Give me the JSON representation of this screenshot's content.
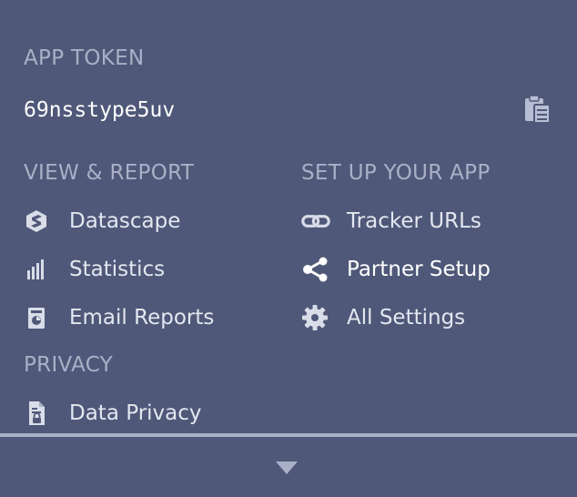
{
  "app_token": {
    "label": "APP TOKEN",
    "value": "69nsstype5uv",
    "copy_icon": "clipboard-icon"
  },
  "view_report": {
    "heading": "VIEW & REPORT",
    "items": [
      {
        "label": "Datascape",
        "icon": "datascape-icon"
      },
      {
        "label": "Statistics",
        "icon": "bar-chart-icon"
      },
      {
        "label": "Email Reports",
        "icon": "email-report-icon"
      }
    ]
  },
  "setup": {
    "heading": "SET UP YOUR APP",
    "items": [
      {
        "label": "Tracker URLs",
        "icon": "link-icon"
      },
      {
        "label": "Partner Setup",
        "icon": "share-icon"
      },
      {
        "label": "All Settings",
        "icon": "gear-icon"
      }
    ]
  },
  "privacy": {
    "heading": "PRIVACY",
    "items": [
      {
        "label": "Data Privacy",
        "icon": "document-lock-icon"
      }
    ]
  },
  "footer": {
    "expand_icon": "chevron-down-icon"
  },
  "colors": {
    "background": "#4f5878",
    "muted_text": "#a9b0c7",
    "text": "#e3e7f0"
  }
}
